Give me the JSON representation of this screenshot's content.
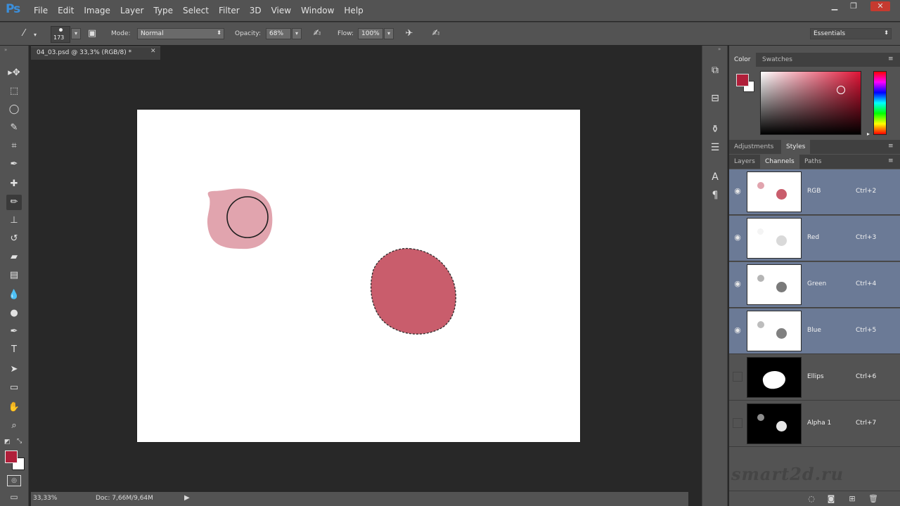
{
  "app": {
    "logo": "Ps"
  },
  "menu": [
    "File",
    "Edit",
    "Image",
    "Layer",
    "Type",
    "Select",
    "Filter",
    "3D",
    "View",
    "Window",
    "Help"
  ],
  "window_controls": {
    "minimize": "▁",
    "restore": "❐",
    "close": "✕"
  },
  "options_bar": {
    "brush_size": "173",
    "mode_label": "Mode:",
    "mode_value": "Normal",
    "opacity_label": "Opacity:",
    "opacity_value": "68%",
    "flow_label": "Flow:",
    "flow_value": "100%",
    "workspace": "Essentials"
  },
  "document": {
    "tab_title": "04_03.psd @ 33,3% (RGB/8) *",
    "zoom": "33,33%",
    "doc_size": "Doc: 7,66M/9,64M"
  },
  "tools": [
    {
      "name": "move-tool",
      "glyph": "▸✥"
    },
    {
      "name": "marquee-tool",
      "glyph": "⬚"
    },
    {
      "name": "lasso-tool",
      "glyph": "◯"
    },
    {
      "name": "quick-selection-tool",
      "glyph": "✎"
    },
    {
      "name": "crop-tool",
      "glyph": "⌗"
    },
    {
      "name": "eyedropper-tool",
      "glyph": "✒"
    },
    {
      "name": "healing-brush-tool",
      "glyph": "✚"
    },
    {
      "name": "brush-tool",
      "glyph": "✏"
    },
    {
      "name": "clone-stamp-tool",
      "glyph": "⊥"
    },
    {
      "name": "history-brush-tool",
      "glyph": "↺"
    },
    {
      "name": "eraser-tool",
      "glyph": "▰"
    },
    {
      "name": "gradient-tool",
      "glyph": "▤"
    },
    {
      "name": "blur-tool",
      "glyph": "💧"
    },
    {
      "name": "dodge-tool",
      "glyph": "●"
    },
    {
      "name": "pen-tool",
      "glyph": "✒"
    },
    {
      "name": "type-tool",
      "glyph": "T"
    },
    {
      "name": "path-selection-tool",
      "glyph": "➤"
    },
    {
      "name": "shape-tool",
      "glyph": "▭"
    },
    {
      "name": "hand-tool",
      "glyph": "✋"
    },
    {
      "name": "zoom-tool",
      "glyph": "⌕"
    }
  ],
  "colors": {
    "foreground": "#b01f3a",
    "background": "#ffffff",
    "shape_light": "#e1a4ae",
    "shape_dark": "#c95d6c",
    "selected_row": "#6b7a96"
  },
  "panels": {
    "color_tabs": [
      "Color",
      "Swatches"
    ],
    "adjust_tabs": [
      "Adjustments",
      "Styles"
    ],
    "layer_tabs": [
      "Layers",
      "Channels",
      "Paths"
    ]
  },
  "channels": [
    {
      "name": "RGB",
      "shortcut": "Ctrl+2",
      "selected": true,
      "visible": true
    },
    {
      "name": "Red",
      "shortcut": "Ctrl+3",
      "selected": true,
      "visible": true
    },
    {
      "name": "Green",
      "shortcut": "Ctrl+4",
      "selected": true,
      "visible": true
    },
    {
      "name": "Blue",
      "shortcut": "Ctrl+5",
      "selected": true,
      "visible": true
    },
    {
      "name": "Ellips",
      "shortcut": "Ctrl+6",
      "selected": false,
      "visible": false
    },
    {
      "name": "Alpha 1",
      "shortcut": "Ctrl+7",
      "selected": false,
      "visible": false
    }
  ],
  "watermark": "smart2d.ru"
}
